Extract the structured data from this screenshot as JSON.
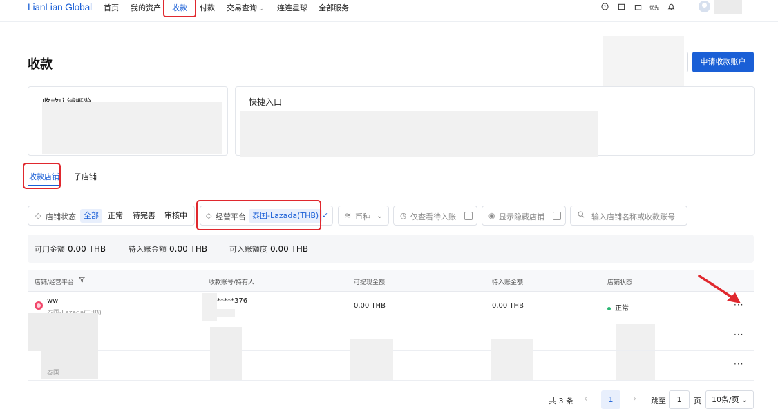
{
  "nav": {
    "logo": "LianLian Global",
    "items": [
      "首页",
      "我的资产",
      "收款",
      "付款",
      "交易查询",
      "连连星球",
      "全部服务"
    ],
    "icons": [
      "help-icon",
      "calendar-icon",
      "gift-icon",
      "promo-icon",
      "bell-icon"
    ],
    "promo_label": "优先"
  },
  "page": {
    "title": "收款",
    "apply_button": "申请收款账户"
  },
  "cards": {
    "overview_title": "收款店铺概览",
    "quick_title": "快捷入口"
  },
  "tabs": [
    "收款店铺",
    "子店铺"
  ],
  "filters": {
    "status_label": "店铺状态",
    "status_options": [
      "全部",
      "正常",
      "待完善",
      "审核中"
    ],
    "platform_label": "经营平台",
    "platform_value": "泰国-Lazada(THB)",
    "currency_label": "币种",
    "pending_only_label": "仅查看待入账",
    "show_hidden_label": "显示隐藏店铺",
    "search_placeholder": "输入店铺名称或收款账号"
  },
  "summary": {
    "available_label": "可用金额",
    "available_value": "0.00 THB",
    "pending_label": "待入账金额",
    "pending_value": "0.00 THB",
    "credit_label": "可入账额度",
    "credit_value": "0.00 THB"
  },
  "table": {
    "headers": [
      "店铺/经营平台",
      "收款账号/持有人",
      "可提现金额",
      "待入账金额",
      "店铺状态"
    ],
    "rows": [
      {
        "shop_name": "ww",
        "platform": "泰国-Lazada(THB)",
        "account": "*****376",
        "withdrawable": "0.00 THB",
        "pending": "0.00 THB",
        "status": "正常",
        "more": "···"
      },
      {
        "more": "···"
      },
      {
        "platform": "泰国",
        "more": "···"
      }
    ]
  },
  "pagination": {
    "total": "共 3 条",
    "prev": "‹",
    "current": "1",
    "next": "›",
    "jump_label": "跳至",
    "jump_value": "1",
    "page_label": "页",
    "page_size": "10条/页"
  },
  "colors": {
    "accent": "#1a5fd6",
    "highlight_box": "#e0282e",
    "status_ok": "#2bb673"
  }
}
